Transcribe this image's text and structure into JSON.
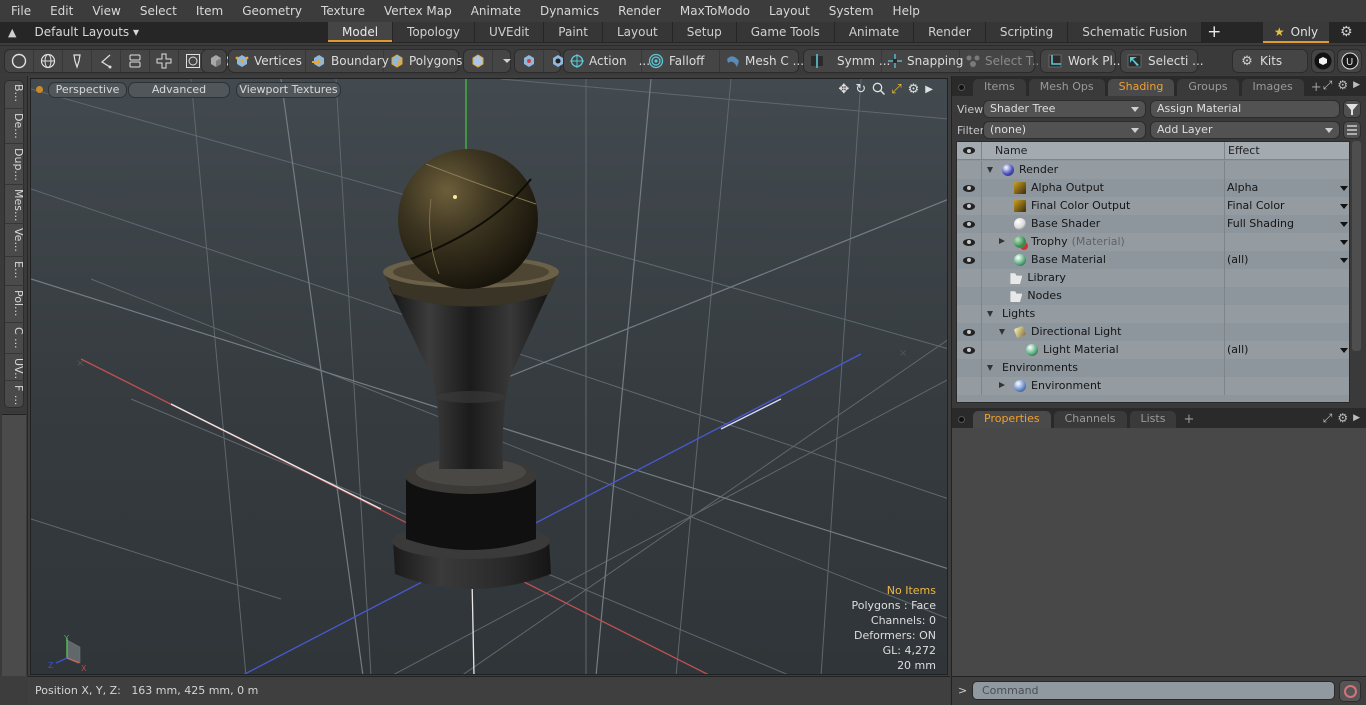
{
  "menu": [
    "File",
    "Edit",
    "View",
    "Select",
    "Item",
    "Geometry",
    "Texture",
    "Vertex Map",
    "Animate",
    "Dynamics",
    "Render",
    "MaxToModo",
    "Layout",
    "System",
    "Help"
  ],
  "layouts": {
    "label": "Default Layouts ▾",
    "tabs": [
      {
        "label": "Model",
        "active": true
      },
      {
        "label": "Topology"
      },
      {
        "label": "UVEdit"
      },
      {
        "label": "Paint"
      },
      {
        "label": "Layout"
      },
      {
        "label": "Setup"
      },
      {
        "label": "Game Tools"
      },
      {
        "label": "Animate"
      },
      {
        "label": "Render"
      },
      {
        "label": "Scripting"
      },
      {
        "label": "Schematic Fusion"
      }
    ],
    "add": "+",
    "only_label": "Only",
    "only_icon": "★"
  },
  "toolbar": {
    "vertices": "Vertices",
    "boundary": "Boundary",
    "polygons": "Polygons",
    "action": "Action",
    "action_more": "...",
    "falloff": "Falloff",
    "mesh": "Mesh C ...",
    "symm": "Symm ...",
    "snapping": "Snapping",
    "select_t": "Select T...",
    "workplane": "Work Pl...",
    "selecti": "Selecti ...",
    "kits": "Kits"
  },
  "left_strip": [
    "B...",
    "De...",
    "Dup...",
    "Mes...",
    "Ve...",
    "E...",
    "Pol...",
    "C ...",
    "UV...",
    "F ..."
  ],
  "viewport": {
    "perspective": "Perspective",
    "advanced": "Advanced",
    "textures": "Viewport Textures",
    "hud": {
      "items": "No Items",
      "polygons": "Polygons : Face",
      "channels": "Channels: 0",
      "deformers": "Deformers: ON",
      "gl": "GL: 4,272",
      "scale": "20 mm"
    },
    "axis": {
      "x": "X",
      "y": "Y",
      "z": "Z"
    }
  },
  "status": {
    "position_label": "Position X, Y, Z:",
    "position_value": "163 mm, 425 mm, 0 m"
  },
  "panel_top": {
    "tabs": [
      {
        "label": "Items"
      },
      {
        "label": "Mesh Ops"
      },
      {
        "label": "Shading",
        "active": true
      },
      {
        "label": "Groups"
      },
      {
        "label": "Images"
      }
    ],
    "add": "+",
    "view_label": "View",
    "view_value": "Shader Tree",
    "assign_material": "Assign Material",
    "filter_label": "Filter",
    "filter_value": "(none)",
    "add_layer": "Add Layer",
    "columns": {
      "name": "Name",
      "effect": "Effect"
    },
    "rows": [
      {
        "name": "Render",
        "effect": "",
        "eye": false,
        "indent": 1,
        "expander": "down",
        "icon": "render-sphere-icon",
        "iconColor": "#4a4fc0",
        "dd": false
      },
      {
        "name": "Alpha Output",
        "effect": "Alpha",
        "eye": true,
        "indent": 2,
        "expander": "",
        "icon": "render-output-icon",
        "iconColor": "#c9a020",
        "dd": true
      },
      {
        "name": "Final Color Output",
        "effect": "Final Color",
        "eye": true,
        "indent": 2,
        "expander": "",
        "icon": "render-output-icon",
        "iconColor": "#c9a020",
        "dd": true
      },
      {
        "name": "Base Shader",
        "effect": "Full Shading",
        "eye": true,
        "indent": 2,
        "expander": "",
        "icon": "shader-sphere-icon",
        "iconColor": "#d8d8d8",
        "dd": true
      },
      {
        "name": "Trophy",
        "suffix": "(Material)",
        "effect": "",
        "eye": true,
        "indent": 2,
        "expander": "right",
        "icon": "material-mask-icon",
        "iconColor": "#cc3333",
        "dd": true
      },
      {
        "name": "Base Material",
        "effect": "(all)",
        "eye": true,
        "indent": 2,
        "expander": "",
        "icon": "material-sphere-icon",
        "iconColor": "#5ab080",
        "dd": true
      },
      {
        "name": "Library",
        "effect": "",
        "eye": false,
        "indent": 1.7,
        "expander": "",
        "icon": "folder-icon",
        "iconColor": "#e8e8e8",
        "dd": false
      },
      {
        "name": "Nodes",
        "effect": "",
        "eye": false,
        "indent": 1.7,
        "expander": "",
        "icon": "folder-icon",
        "iconColor": "#e8e8e8",
        "dd": false
      },
      {
        "name": "Lights",
        "effect": "",
        "eye": false,
        "indent": 1,
        "expander": "down",
        "icon": "",
        "iconColor": "",
        "dd": false
      },
      {
        "name": "Directional Light",
        "effect": "",
        "eye": true,
        "indent": 2,
        "expander": "down",
        "icon": "directional-light-icon",
        "iconColor": "#e8d890",
        "dd": false
      },
      {
        "name": "Light Material",
        "effect": "(all)",
        "eye": true,
        "indent": 3,
        "expander": "",
        "icon": "material-sphere-icon",
        "iconColor": "#5ab080",
        "dd": true
      },
      {
        "name": "Environments",
        "effect": "",
        "eye": false,
        "indent": 1,
        "expander": "down",
        "icon": "",
        "iconColor": "",
        "dd": false
      },
      {
        "name": "Environment",
        "effect": "",
        "eye": false,
        "indent": 2,
        "expander": "right",
        "icon": "environment-sphere-icon",
        "iconColor": "#6a90d0",
        "dd": false
      }
    ]
  },
  "panel_bottom": {
    "tabs": [
      {
        "label": "Properties",
        "active": true
      },
      {
        "label": "Channels"
      },
      {
        "label": "Lists"
      }
    ],
    "add": "+"
  },
  "command": {
    "prompt": ">",
    "placeholder": "Command"
  },
  "colors": {
    "accent": "#e29a2e",
    "hud_highlight": "#f0b840",
    "axis_x": "#c04848",
    "axis_y": "#40b040",
    "axis_z": "#4050d0"
  }
}
